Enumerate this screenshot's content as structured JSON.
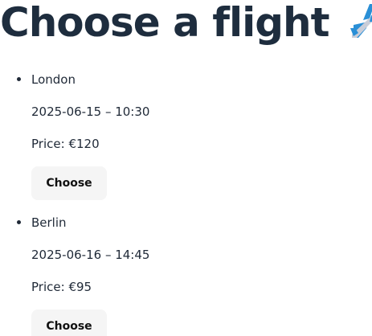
{
  "header": {
    "title": "Choose a flight",
    "icon": "airplane-icon"
  },
  "flights": [
    {
      "destination": "London",
      "datetime": "2025-06-15 – 10:30",
      "price_label": "Price:",
      "price": "€120",
      "button_label": "Choose"
    },
    {
      "destination": "Berlin",
      "datetime": "2025-06-16 – 14:45",
      "price_label": "Price:",
      "price": "€95",
      "button_label": "Choose"
    }
  ],
  "colors": {
    "title": "#1e2d3e",
    "text": "#1f2937",
    "button_bg": "#f5f5f5",
    "plane_body": "#c9cdd8",
    "plane_accent": "#2a8fd6"
  }
}
